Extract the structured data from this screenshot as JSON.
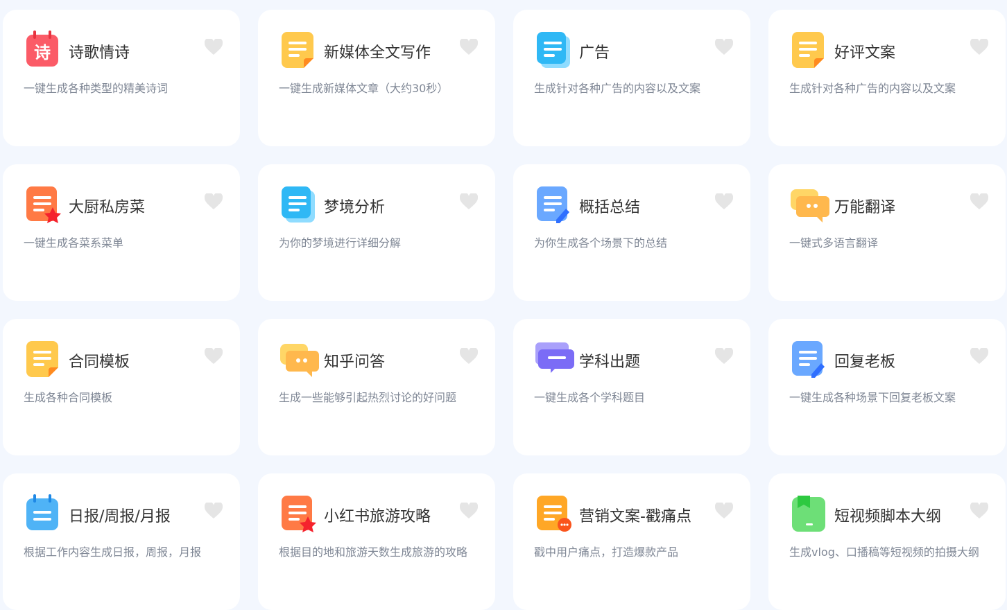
{
  "cards": [
    {
      "title": "诗歌情诗",
      "desc": "一键生成各种类型的精美诗词",
      "icon": "poem-calendar-icon",
      "color": "#fb5b67"
    },
    {
      "title": "新媒体全文写作",
      "desc": "一键生成新媒体文章（大约30秒）",
      "icon": "document-icon",
      "color": "#ffc94d"
    },
    {
      "title": "广告",
      "desc": "生成针对各种广告的内容以及文案",
      "icon": "document-stack-icon",
      "color": "#2fb8f5"
    },
    {
      "title": "好评文案",
      "desc": "生成针对各种广告的内容以及文案",
      "icon": "document-icon",
      "color": "#ffc94d"
    },
    {
      "title": "大厨私房菜",
      "desc": "一键生成各菜系菜单",
      "icon": "document-star-icon",
      "color": "#ff7a45"
    },
    {
      "title": "梦境分析",
      "desc": "为你的梦境进行详细分解",
      "icon": "document-stack-icon",
      "color": "#2fb8f5"
    },
    {
      "title": "概括总结",
      "desc": "为你生成各个场景下的总结",
      "icon": "document-pen-icon",
      "color": "#6aa8ff"
    },
    {
      "title": "万能翻译",
      "desc": "一键式多语言翻译",
      "icon": "chat-bubble-icon",
      "color": "#ffb84d"
    },
    {
      "title": "合同模板",
      "desc": "生成各种合同模板",
      "icon": "document-icon",
      "color": "#ffc94d"
    },
    {
      "title": "知乎问答",
      "desc": "生成一些能够引起热烈讨论的好问题",
      "icon": "chat-bubble-icon",
      "color": "#ffb84d"
    },
    {
      "title": "学科出题",
      "desc": "一键生成各个学科题目",
      "icon": "chat-purple-icon",
      "color": "#7b6cf6"
    },
    {
      "title": "回复老板",
      "desc": "一键生成各种场景下回复老板文案",
      "icon": "document-pen-icon",
      "color": "#6aa8ff"
    },
    {
      "title": "日报/周报/月报",
      "desc": "根据工作内容生成日报，周报，月报",
      "icon": "calendar-icon",
      "color": "#4fb3f6"
    },
    {
      "title": "小红书旅游攻略",
      "desc": "根据目的地和旅游天数生成旅游的攻略",
      "icon": "document-star-icon",
      "color": "#ff7a45"
    },
    {
      "title": "营销文案-戳痛点",
      "desc": "戳中用户痛点，打造爆款产品",
      "icon": "document-chat-icon",
      "color": "#ffa726"
    },
    {
      "title": "短视频脚本大纲",
      "desc": "生成vlog、口播稿等短视频的拍摄大纲",
      "icon": "bookmark-box-icon",
      "color": "#6ddf77"
    }
  ],
  "poem_glyph": "诗"
}
